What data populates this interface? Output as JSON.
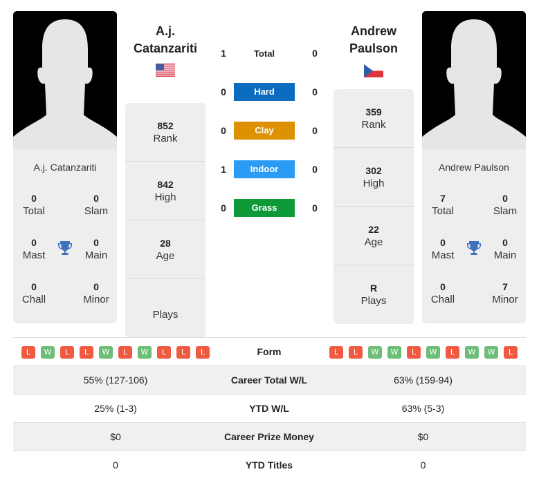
{
  "colors": {
    "hard": "#0b6bbf",
    "clay": "#dd9100",
    "indoor": "#2b9bf4",
    "grass": "#0f9a3a",
    "win": "#6cbd76",
    "loss": "#ef5a41",
    "trophy": "#3f72bd"
  },
  "player1": {
    "name_line1": "A.j.",
    "name_line2": "Catanzariti",
    "full_name": "A.j. Catanzariti",
    "flag_icon": "usa-flag-icon",
    "titles": {
      "total": {
        "value": "0",
        "label": "Total"
      },
      "slam": {
        "value": "0",
        "label": "Slam"
      },
      "mast": {
        "value": "0",
        "label": "Mast"
      },
      "main": {
        "value": "0",
        "label": "Main"
      },
      "chall": {
        "value": "0",
        "label": "Chall"
      },
      "minor": {
        "value": "0",
        "label": "Minor"
      }
    },
    "stats": {
      "rank": {
        "value": "852",
        "label": "Rank"
      },
      "high": {
        "value": "842",
        "label": "High"
      },
      "age": {
        "value": "28",
        "label": "Age"
      },
      "plays": {
        "value": "",
        "label": "Plays"
      }
    },
    "form": [
      "L",
      "W",
      "L",
      "L",
      "W",
      "L",
      "W",
      "L",
      "L",
      "L"
    ]
  },
  "player2": {
    "name_line1": "Andrew",
    "name_line2": "Paulson",
    "full_name": "Andrew Paulson",
    "flag_icon": "czech-flag-icon",
    "titles": {
      "total": {
        "value": "7",
        "label": "Total"
      },
      "slam": {
        "value": "0",
        "label": "Slam"
      },
      "mast": {
        "value": "0",
        "label": "Mast"
      },
      "main": {
        "value": "0",
        "label": "Main"
      },
      "chall": {
        "value": "0",
        "label": "Chall"
      },
      "minor": {
        "value": "7",
        "label": "Minor"
      }
    },
    "stats": {
      "rank": {
        "value": "359",
        "label": "Rank"
      },
      "high": {
        "value": "302",
        "label": "High"
      },
      "age": {
        "value": "22",
        "label": "Age"
      },
      "plays": {
        "value": "R",
        "label": "Plays"
      }
    },
    "form": [
      "L",
      "L",
      "W",
      "W",
      "L",
      "W",
      "L",
      "W",
      "W",
      "L"
    ]
  },
  "h2h": {
    "total": {
      "label": "Total",
      "p1": "1",
      "p2": "0"
    },
    "hard": {
      "label": "Hard",
      "p1": "0",
      "p2": "0"
    },
    "clay": {
      "label": "Clay",
      "p1": "0",
      "p2": "0"
    },
    "indoor": {
      "label": "Indoor",
      "p1": "1",
      "p2": "0"
    },
    "grass": {
      "label": "Grass",
      "p1": "0",
      "p2": "0"
    }
  },
  "table": {
    "form_label": "Form",
    "rows": [
      {
        "label": "Career Total W/L",
        "p1": "55% (127-106)",
        "p2": "63% (159-94)"
      },
      {
        "label": "YTD W/L",
        "p1": "25% (1-3)",
        "p2": "63% (5-3)"
      },
      {
        "label": "Career Prize Money",
        "p1": "$0",
        "p2": "$0"
      },
      {
        "label": "YTD Titles",
        "p1": "0",
        "p2": "0"
      }
    ]
  }
}
